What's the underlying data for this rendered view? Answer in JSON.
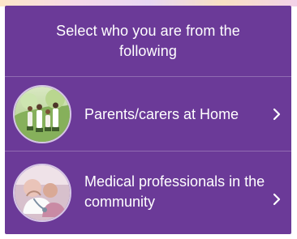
{
  "prompt": {
    "title": "Select who you are from the following"
  },
  "options": [
    {
      "label": "Parents/carers at Home",
      "icon": "family-photo-icon"
    },
    {
      "label": "Medical professionals in the community",
      "icon": "medical-professional-photo-icon"
    }
  ],
  "theme": {
    "panel": "#6b3a98",
    "text": "#ffffff"
  }
}
